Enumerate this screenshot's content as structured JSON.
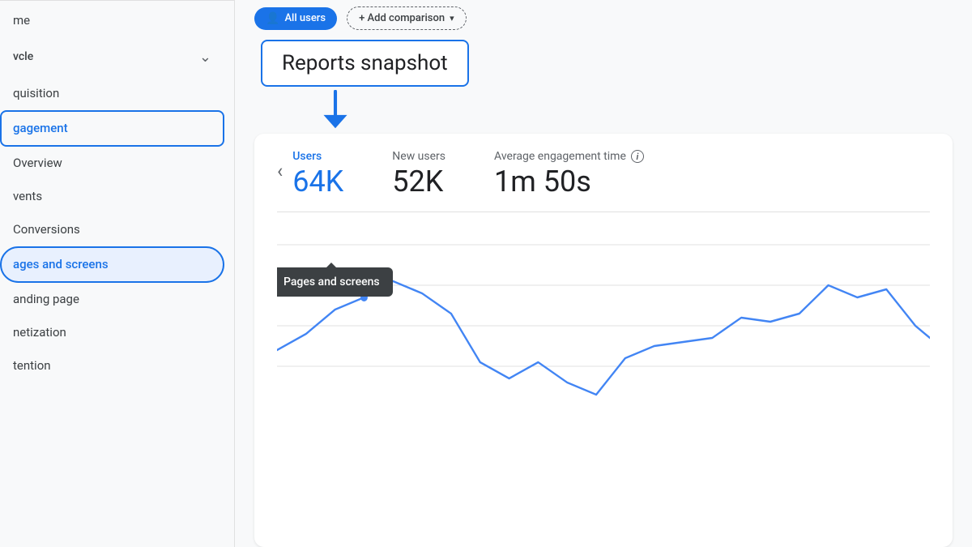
{
  "sidebar": {
    "items": [
      {
        "id": "home",
        "label": "me",
        "active": false
      },
      {
        "id": "lifecycle",
        "label": "vcle",
        "active": false,
        "hasChevron": true,
        "expanded": true
      },
      {
        "id": "acquisition",
        "label": "quisition",
        "active": false
      },
      {
        "id": "engagement",
        "label": "gagement",
        "active": false,
        "activeOutline": true
      },
      {
        "id": "overview",
        "label": "Overview",
        "active": false
      },
      {
        "id": "events",
        "label": "vents",
        "active": false
      },
      {
        "id": "conversions",
        "label": "Conversions",
        "active": false
      },
      {
        "id": "pages-screens",
        "label": "ages and screens",
        "active": true,
        "activeBg": true
      },
      {
        "id": "landing-page",
        "label": "anding page",
        "active": false
      },
      {
        "id": "monetization",
        "label": "netization",
        "active": false
      },
      {
        "id": "retention",
        "label": "tention",
        "active": false
      }
    ]
  },
  "topbar": {
    "pill_allUsers": "All users",
    "pill_addComparison": "+ Add comparison"
  },
  "snapshot": {
    "title": "Reports snapshot",
    "arrowAlt": "points to Users metric"
  },
  "metrics": {
    "nav_prev": "‹",
    "items": [
      {
        "id": "users",
        "label": "Users",
        "value": "64K",
        "isBlue": true
      },
      {
        "id": "new-users",
        "label": "New users",
        "value": "52K",
        "isBlue": false
      },
      {
        "id": "avg-engagement",
        "label": "Average engagement time",
        "value": "1m 50s",
        "isBlue": false,
        "hasInfo": true
      }
    ]
  },
  "tooltip": {
    "text": "Pages and screens"
  },
  "chart": {
    "lineColor": "#4285f4",
    "gridColor": "#e0e0e0"
  }
}
